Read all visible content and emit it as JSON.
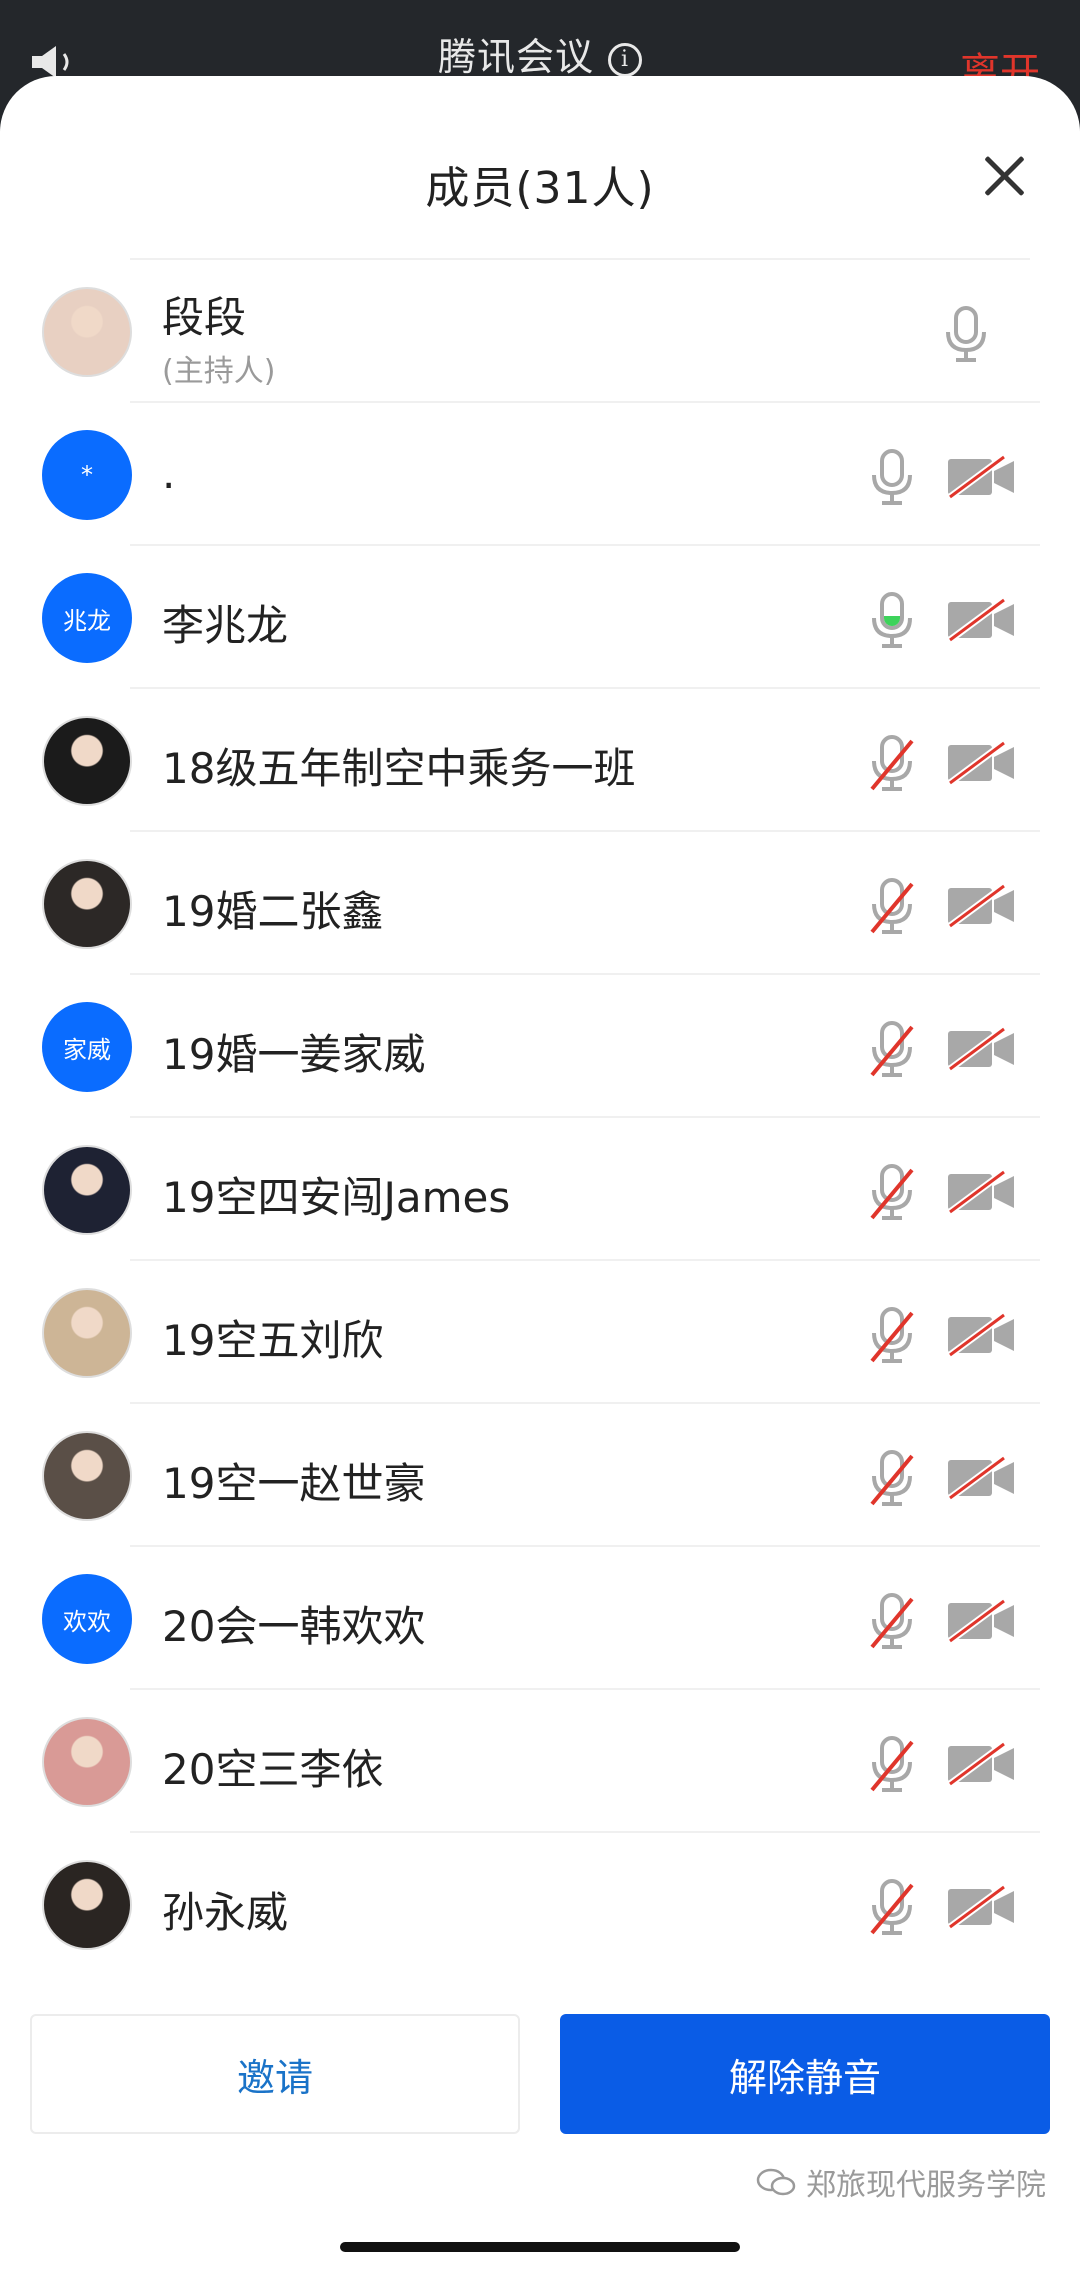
{
  "topbar": {
    "title": "腾讯会议",
    "info_symbol": "i",
    "leave_label": "离开"
  },
  "sheet": {
    "title": "成员(31人)"
  },
  "members": [
    {
      "name": "段段",
      "role": "(主持人)",
      "avatar_text": "",
      "avatar_type": "photo",
      "avatar_color": "#e8d0c2",
      "mic": "on",
      "cam": "none"
    },
    {
      "name": ".",
      "role": "",
      "avatar_text": "*",
      "avatar_type": "blue",
      "mic": "on",
      "cam": "off"
    },
    {
      "name": "李兆龙",
      "role": "",
      "avatar_text": "兆龙",
      "avatar_type": "blue",
      "mic": "speaking",
      "cam": "off"
    },
    {
      "name": "18级五年制空中乘务一班",
      "role": "",
      "avatar_text": "",
      "avatar_type": "photo",
      "avatar_color": "#1b1b1b",
      "mic": "muted",
      "cam": "off"
    },
    {
      "name": "19婚二张鑫",
      "role": "",
      "avatar_text": "",
      "avatar_type": "photo",
      "avatar_color": "#2c2826",
      "mic": "muted",
      "cam": "off"
    },
    {
      "name": "19婚一姜家威",
      "role": "",
      "avatar_text": "家威",
      "avatar_type": "blue",
      "mic": "muted",
      "cam": "off"
    },
    {
      "name": "19空四安闯James",
      "role": "",
      "avatar_text": "",
      "avatar_type": "photo",
      "avatar_color": "#1e2233",
      "mic": "muted",
      "cam": "off"
    },
    {
      "name": "19空五刘欣",
      "role": "",
      "avatar_text": "",
      "avatar_type": "photo",
      "avatar_color": "#cdb596",
      "mic": "muted",
      "cam": "off"
    },
    {
      "name": "19空一赵世豪",
      "role": "",
      "avatar_text": "",
      "avatar_type": "photo",
      "avatar_color": "#5a4f47",
      "mic": "muted",
      "cam": "off"
    },
    {
      "name": "20会一韩欢欢",
      "role": "",
      "avatar_text": "欢欢",
      "avatar_type": "blue",
      "mic": "muted",
      "cam": "off"
    },
    {
      "name": "20空三李依",
      "role": "",
      "avatar_text": "",
      "avatar_type": "photo",
      "avatar_color": "#d99a96",
      "mic": "muted",
      "cam": "off"
    },
    {
      "name": "孙永威",
      "role": "",
      "avatar_text": "",
      "avatar_type": "photo",
      "avatar_color": "#2a2522",
      "mic": "muted",
      "cam": "off"
    }
  ],
  "actions": {
    "invite_label": "邀请",
    "unmute_label": "解除静音"
  },
  "watermark": {
    "text": "郑旅现代服务学院"
  },
  "colors": {
    "accent": "#0a5ce6",
    "speaking": "#3dd35b",
    "muted_slash": "#e0352b",
    "icon_gray": "#a8a8a8"
  }
}
